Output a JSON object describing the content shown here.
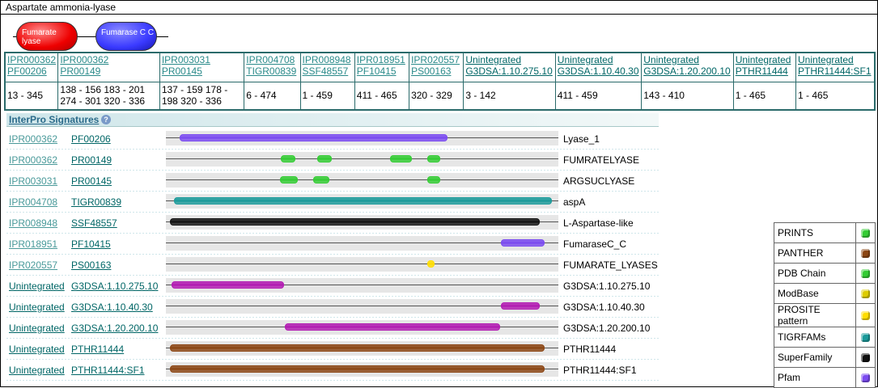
{
  "title": "Aspartate ammonia-lyase",
  "domains": [
    {
      "label": "Fumarate lyase",
      "color": "#e00000"
    },
    {
      "label": "Fumarase C C",
      "color": "#3030ff"
    }
  ],
  "matches_table": [
    {
      "ids": [
        "IPR000362",
        "PF00206"
      ],
      "range": "13 - 345",
      "dark": false
    },
    {
      "ids": [
        "IPR000362",
        "PR00149"
      ],
      "range": "138 - 156 183 - 201 274 - 301 320 - 336",
      "dark": false
    },
    {
      "ids": [
        "IPR003031",
        "PR00145"
      ],
      "range": "137 - 159 178 - 198 320 - 336",
      "dark": false
    },
    {
      "ids": [
        "IPR004708",
        "TIGR00839"
      ],
      "range": "6 - 474",
      "dark": false
    },
    {
      "ids": [
        "IPR008948",
        "SSF48557"
      ],
      "range": "1 - 459",
      "dark": false
    },
    {
      "ids": [
        "IPR018951",
        "PF10415"
      ],
      "range": "411 - 465",
      "dark": false
    },
    {
      "ids": [
        "IPR020557",
        "PS00163"
      ],
      "range": "320 - 329",
      "dark": false
    },
    {
      "ids": [
        "Unintegrated",
        "G3DSA:1.10.275.10"
      ],
      "range": "3 - 142",
      "dark": true
    },
    {
      "ids": [
        "Unintegrated",
        "G3DSA:1.10.40.30"
      ],
      "range": "411 - 459",
      "dark": true
    },
    {
      "ids": [
        "Unintegrated",
        "G3DSA:1.20.200.10"
      ],
      "range": "143 - 410",
      "dark": true
    },
    {
      "ids": [
        "Unintegrated",
        "PTHR11444"
      ],
      "range": "1 - 465",
      "dark": true
    },
    {
      "ids": [
        "Unintegrated",
        "PTHR11444:SF1"
      ],
      "range": "1 - 465",
      "dark": true
    }
  ],
  "signatures_header": "InterPro Signatures",
  "help_icon": "question-icon",
  "sequence_length": 478,
  "signatures": [
    {
      "id1": "IPR000362",
      "id2": "PF00206",
      "label": "Lyase_1",
      "color": "#7a4af0",
      "dark": false,
      "segments": [
        [
          13,
          345
        ]
      ]
    },
    {
      "id1": "IPR000362",
      "id2": "PR00149",
      "label": "FUMRATELYASE",
      "color": "#33cc33",
      "dark": false,
      "segments": [
        [
          138,
          156
        ],
        [
          183,
          201
        ],
        [
          274,
          301
        ],
        [
          320,
          336
        ]
      ]
    },
    {
      "id1": "IPR003031",
      "id2": "PR00145",
      "label": "ARGSUCLYASE",
      "color": "#33cc33",
      "dark": false,
      "segments": [
        [
          137,
          159
        ],
        [
          178,
          198
        ],
        [
          320,
          336
        ]
      ]
    },
    {
      "id1": "IPR004708",
      "id2": "TIGR00839",
      "label": "aspA",
      "color": "#1a9a9a",
      "dark": false,
      "segments": [
        [
          6,
          474
        ]
      ]
    },
    {
      "id1": "IPR008948",
      "id2": "SSF48557",
      "label": "L-Aspartase-like",
      "color": "#111111",
      "dark": false,
      "segments": [
        [
          1,
          459
        ]
      ]
    },
    {
      "id1": "IPR018951",
      "id2": "PF10415",
      "label": "FumaraseC_C",
      "color": "#7a4af0",
      "dark": false,
      "segments": [
        [
          411,
          465
        ]
      ]
    },
    {
      "id1": "IPR020557",
      "id2": "PS00163",
      "label": "FUMARATE_LYASES",
      "color": "#ffdd00",
      "dark": false,
      "segments": [
        [
          320,
          329
        ]
      ]
    },
    {
      "id1": "Unintegrated",
      "id2": "G3DSA:1.10.275.10",
      "label": "G3DSA:1.10.275.10",
      "color": "#b21ab2",
      "dark": true,
      "segments": [
        [
          3,
          142
        ]
      ]
    },
    {
      "id1": "Unintegrated",
      "id2": "G3DSA:1.10.40.30",
      "label": "G3DSA:1.10.40.30",
      "color": "#b21ab2",
      "dark": true,
      "segments": [
        [
          411,
          459
        ]
      ]
    },
    {
      "id1": "Unintegrated",
      "id2": "G3DSA:1.20.200.10",
      "label": "G3DSA:1.20.200.10",
      "color": "#b21ab2",
      "dark": true,
      "segments": [
        [
          143,
          410
        ]
      ]
    },
    {
      "id1": "Unintegrated",
      "id2": "PTHR11444",
      "label": "PTHR11444",
      "color": "#8b4513",
      "dark": true,
      "segments": [
        [
          1,
          465
        ]
      ]
    },
    {
      "id1": "Unintegrated",
      "id2": "PTHR11444:SF1",
      "label": "PTHR11444:SF1",
      "color": "#8b4513",
      "dark": true,
      "segments": [
        [
          1,
          465
        ]
      ]
    }
  ],
  "legend": [
    {
      "label": "PRINTS",
      "color": "#33cc33",
      "icon": "prints-icon"
    },
    {
      "label": "PANTHER",
      "color": "#8b4513",
      "icon": "panther-icon"
    },
    {
      "label": "PDB Chain",
      "color": "#33cc33",
      "icon": "pdb-chain-icon"
    },
    {
      "label": "ModBase",
      "color": "#ddcc00",
      "icon": "modbase-icon"
    },
    {
      "label": "PROSITE pattern",
      "color": "#ffdd00",
      "icon": "prosite-pattern-icon"
    },
    {
      "label": "TIGRFAMs",
      "color": "#1a9a9a",
      "icon": "tigrfams-icon"
    },
    {
      "label": "SuperFamily",
      "color": "#111111",
      "icon": "superfamily-icon"
    },
    {
      "label": "Pfam",
      "color": "#7a4af0",
      "icon": "pfam-icon"
    }
  ]
}
